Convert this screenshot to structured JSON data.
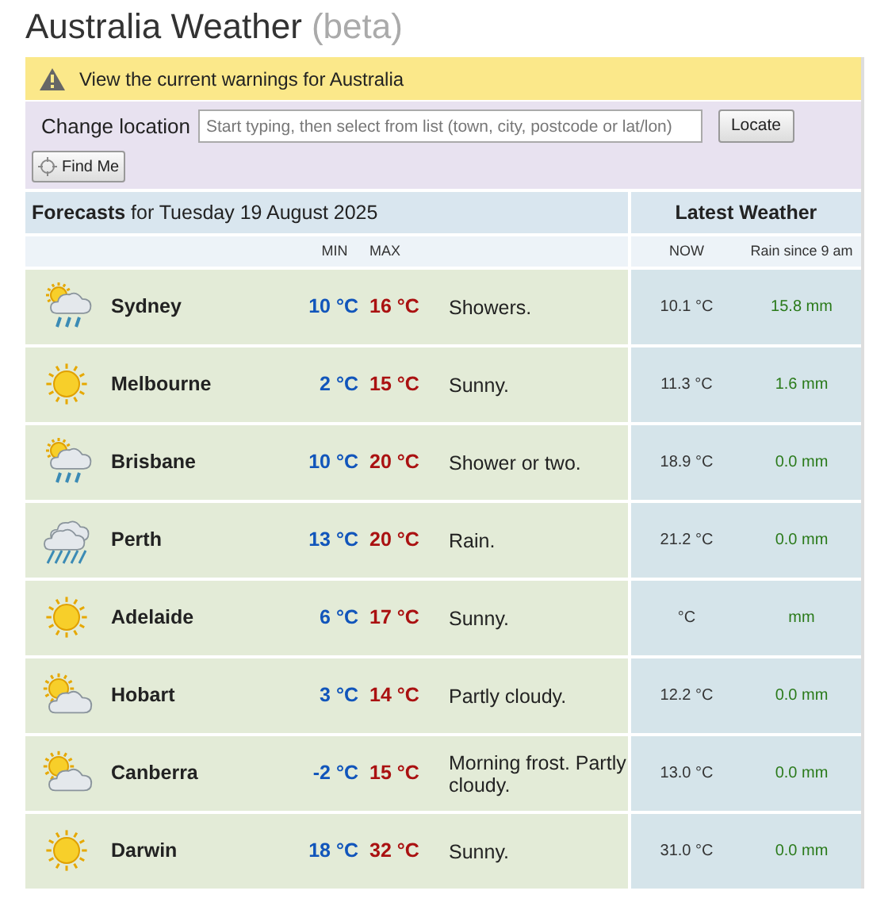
{
  "page": {
    "title": "Australia Weather",
    "title_suffix": "(beta)"
  },
  "warning": {
    "text": "View the current warnings for Australia"
  },
  "location": {
    "label": "Change location",
    "placeholder": "Start typing, then select from list (town, city, postcode or lat/lon)",
    "locate_button": "Locate",
    "find_me_button": "Find Me"
  },
  "forecast_header": "**Forecasts** for Tuesday 19 August 2025",
  "latest_header": "Latest Weather",
  "columns": {
    "min": "MIN",
    "max": "MAX",
    "now": "NOW",
    "rain": "Rain since 9 am"
  },
  "rows": [
    {
      "kind": "showers",
      "city": "Sydney",
      "min": "10 °C",
      "max": "16 °C",
      "forecast": "Showers.",
      "now": "10.1 °C",
      "rain": "15.8 mm"
    },
    {
      "kind": "sunny",
      "city": "Melbourne",
      "min": "2 °C",
      "max": "15 °C",
      "forecast": "Sunny.",
      "now": "11.3 °C",
      "rain": "1.6 mm"
    },
    {
      "kind": "showers",
      "city": "Brisbane",
      "min": "10 °C",
      "max": "20 °C",
      "forecast": "Shower or two.",
      "now": "18.9 °C",
      "rain": "0.0 mm"
    },
    {
      "kind": "rain",
      "city": "Perth",
      "min": "13 °C",
      "max": "20 °C",
      "forecast": "Rain.",
      "now": "21.2 °C",
      "rain": "0.0 mm"
    },
    {
      "kind": "sunny",
      "city": "Adelaide",
      "min": "6 °C",
      "max": "17 °C",
      "forecast": "Sunny.",
      "now": "°C",
      "rain": "mm"
    },
    {
      "kind": "partly_cloudy",
      "city": "Hobart",
      "min": "3 °C",
      "max": "14 °C",
      "forecast": "Partly cloudy.",
      "now": "12.2 °C",
      "rain": "0.0 mm"
    },
    {
      "kind": "partly_cloudy",
      "city": "Canberra",
      "min": "-2 °C",
      "max": "15 °C",
      "forecast": "Morning frost. Partly cloudy.",
      "now": "13.0 °C",
      "rain": "0.0 mm"
    },
    {
      "kind": "sunny",
      "city": "Darwin",
      "min": "18 °C",
      "max": "32 °C",
      "forecast": "Sunny.",
      "now": "31.0 °C",
      "rain": "0.0 mm"
    }
  ]
}
